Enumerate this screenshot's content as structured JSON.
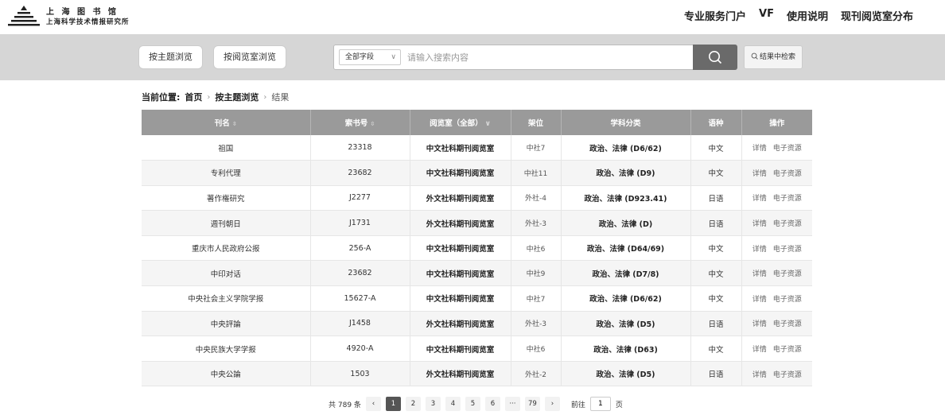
{
  "header": {
    "logo_line1": "上 海 图 书 馆",
    "logo_line2": "上海科学技术情报研究所",
    "nav": [
      "专业服务门户",
      "VF",
      "使用说明",
      "现刊阅览室分布"
    ]
  },
  "search_bar": {
    "browse_by_subject": "按主题浏览",
    "browse_by_room": "按阅览室浏览",
    "field_select": "全部字段",
    "placeholder": "请输入搜索内容",
    "search_in_results": "结果中检索"
  },
  "breadcrumb": {
    "label": "当前位置:",
    "items": [
      "首页",
      "按主题浏览"
    ],
    "current": "结果"
  },
  "table": {
    "columns": [
      "刊名",
      "索书号",
      "阅览室（全部）",
      "架位",
      "学科分类",
      "语种",
      "操作"
    ],
    "action_details": "详情",
    "action_eresource": "电子资源",
    "rows": [
      {
        "title": "祖国",
        "call": "23318",
        "room": "中文社科期刊阅览室",
        "shelf": "中社7",
        "subject": "政治、法律 (D6/62)",
        "lang": "中文"
      },
      {
        "title": "专利代理",
        "call": "23682",
        "room": "中文社科期刊阅览室",
        "shelf": "中社11",
        "subject": "政治、法律 (D9)",
        "lang": "中文"
      },
      {
        "title": "著作権研究",
        "call": "J2277",
        "room": "外文社科期刊阅览室",
        "shelf": "外社-4",
        "subject": "政治、法律 (D923.41)",
        "lang": "日语"
      },
      {
        "title": "週刊朝日",
        "call": "J1731",
        "room": "外文社科期刊阅览室",
        "shelf": "外社-3",
        "subject": "政治、法律 (D)",
        "lang": "日语"
      },
      {
        "title": "重庆市人民政府公报",
        "call": "256-A",
        "room": "中文社科期刊阅览室",
        "shelf": "中社6",
        "subject": "政治、法律 (D64/69)",
        "lang": "中文"
      },
      {
        "title": "中印对话",
        "call": "23682",
        "room": "中文社科期刊阅览室",
        "shelf": "中社9",
        "subject": "政治、法律 (D7/8)",
        "lang": "中文"
      },
      {
        "title": "中央社会主义学院学报",
        "call": "15627-A",
        "room": "中文社科期刊阅览室",
        "shelf": "中社7",
        "subject": "政治、法律 (D6/62)",
        "lang": "中文"
      },
      {
        "title": "中央評論",
        "call": "J1458",
        "room": "外文社科期刊阅览室",
        "shelf": "外社-3",
        "subject": "政治、法律 (D5)",
        "lang": "日语"
      },
      {
        "title": "中央民族大学学报",
        "call": "4920-A",
        "room": "中文社科期刊阅览室",
        "shelf": "中社6",
        "subject": "政治、法律 (D63)",
        "lang": "中文"
      },
      {
        "title": "中央公論",
        "call": "1503",
        "room": "外文社科期刊阅览室",
        "shelf": "外社-2",
        "subject": "政治、法律 (D5)",
        "lang": "日语"
      }
    ]
  },
  "pagination": {
    "total_text": "共 789 条",
    "pages": [
      "1",
      "2",
      "3",
      "4",
      "5",
      "6",
      "···",
      "79"
    ],
    "current_page": "1",
    "goto_prefix": "前往",
    "goto_value": "1",
    "goto_suffix": "页"
  }
}
